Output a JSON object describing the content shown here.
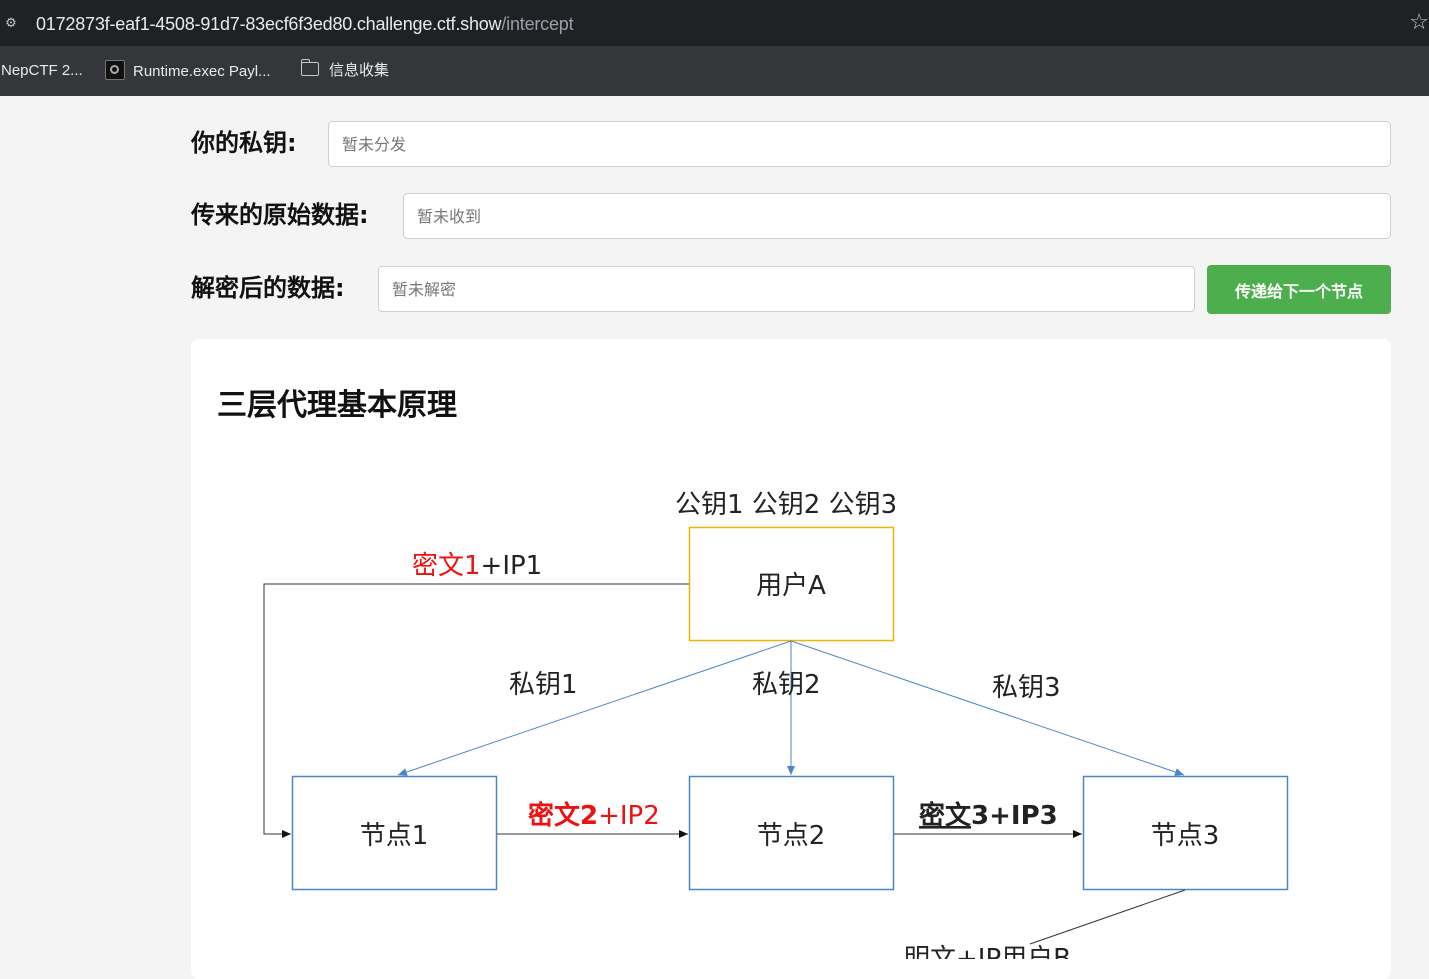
{
  "browser": {
    "url_host": "0172873f-eaf1-4508-91d7-83ecf6f3ed80.challenge.ctf.show",
    "url_path": "/intercept",
    "bookmarks": [
      {
        "label": "NepCTF 2..."
      },
      {
        "label": "Runtime.exec Payl..."
      },
      {
        "label": "信息收集",
        "icon": "folder-icon"
      }
    ]
  },
  "form": {
    "private_key_label": "你的私钥:",
    "private_key_placeholder": "暂未分发",
    "raw_data_label": "传来的原始数据:",
    "raw_data_placeholder": "暂未收到",
    "decrypted_label": "解密后的数据:",
    "decrypted_placeholder": "暂未解密",
    "forward_button": "传递给下一个节点"
  },
  "card": {
    "title": "三层代理基本原理"
  },
  "diagram": {
    "public_keys": "公钥1 公钥2 公钥3",
    "user_a": "用户A",
    "node1": "节点1",
    "node2": "节点2",
    "node3": "节点3",
    "priv1": "私钥1",
    "priv2": "私钥2",
    "priv3": "私钥3",
    "edge1_red": "密文1",
    "edge1_rest": "+IP1",
    "edge2_red": "密文2",
    "edge2_rest": "+IP2",
    "edge3": "密文3+IP3",
    "edge3_underlined": "密文",
    "edge3_rest": "3+IP3",
    "bottom_partial": "明文+IP用户B",
    "colors": {
      "user_box": "#f0b400",
      "node_box": "#4a86c8",
      "red": "#ee1111"
    }
  }
}
